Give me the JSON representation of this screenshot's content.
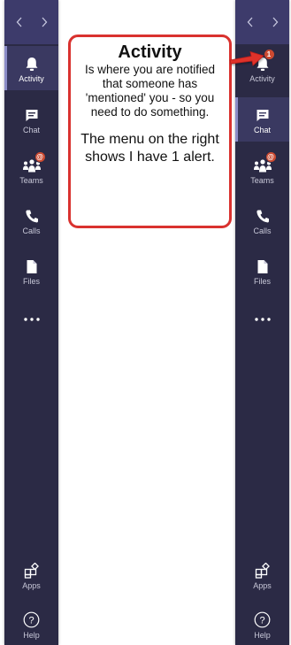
{
  "left_rail": {
    "items": [
      {
        "label": "Activity",
        "icon": "bell-icon"
      },
      {
        "label": "Chat",
        "icon": "chat-icon"
      },
      {
        "label": "Teams",
        "icon": "teams-icon",
        "badge": "@"
      },
      {
        "label": "Calls",
        "icon": "phone-icon"
      },
      {
        "label": "Files",
        "icon": "file-icon"
      }
    ],
    "more": "...",
    "bottom_items": [
      {
        "label": "Apps",
        "icon": "apps-icon"
      },
      {
        "label": "Help",
        "icon": "help-icon"
      }
    ]
  },
  "right_rail": {
    "items": [
      {
        "label": "Activity",
        "icon": "bell-icon",
        "badge": "1"
      },
      {
        "label": "Chat",
        "icon": "chat-icon"
      },
      {
        "label": "Teams",
        "icon": "teams-icon",
        "badge": "@"
      },
      {
        "label": "Calls",
        "icon": "phone-icon"
      },
      {
        "label": "Files",
        "icon": "file-icon"
      }
    ],
    "more": "...",
    "bottom_items": [
      {
        "label": "Apps",
        "icon": "apps-icon"
      },
      {
        "label": "Help",
        "icon": "help-icon"
      }
    ]
  },
  "callout": {
    "title": "Activity",
    "body": "Is where you are notified that someone has 'mentioned' you - so you need to do something.",
    "body2": "The menu on the right shows I have 1 alert."
  },
  "colors": {
    "rail_bg": "#2b2a45",
    "rail_header": "#3d3b6b",
    "active_bg": "#3a3961",
    "badge": "#cc4a31",
    "callout_border": "#d9322f"
  }
}
